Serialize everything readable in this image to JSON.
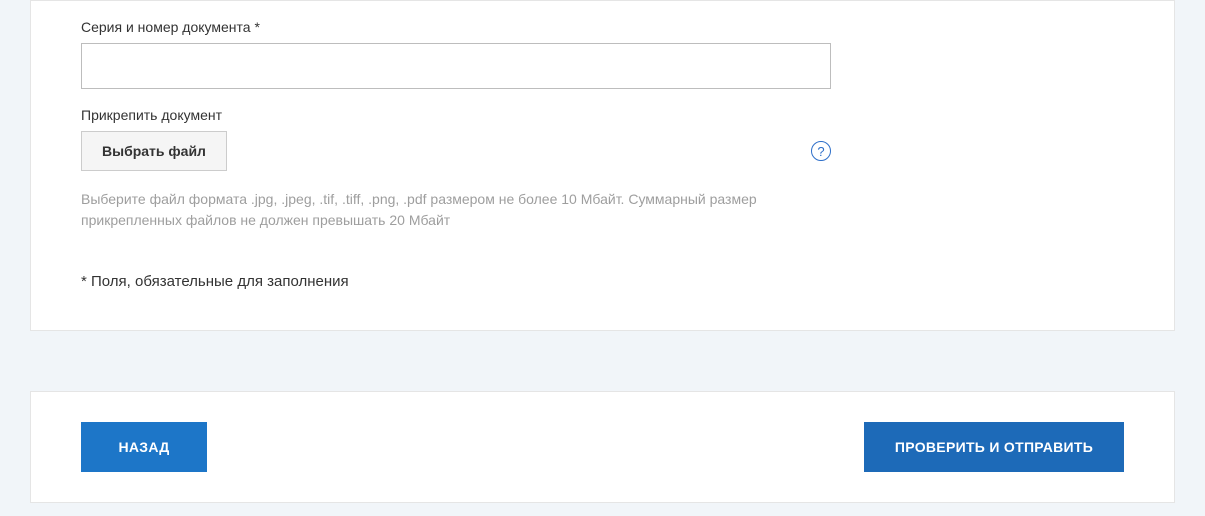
{
  "form": {
    "doc_number_label": "Серия и номер документа *",
    "doc_number_value": "",
    "attach_label": "Прикрепить документ",
    "file_button_label": "Выбрать файл",
    "help_icon_glyph": "?",
    "file_hint": "Выберите файл формата .jpg, .jpeg, .tif, .tiff, .png, .pdf размером не более 10 Мбайт. Суммарный размер прикрепленных файлов не должен превышать 20 Мбайт",
    "required_note": "* Поля, обязательные для заполнения"
  },
  "actions": {
    "back_label": "НАЗАД",
    "submit_label": "ПРОВЕРИТЬ И ОТПРАВИТЬ"
  }
}
